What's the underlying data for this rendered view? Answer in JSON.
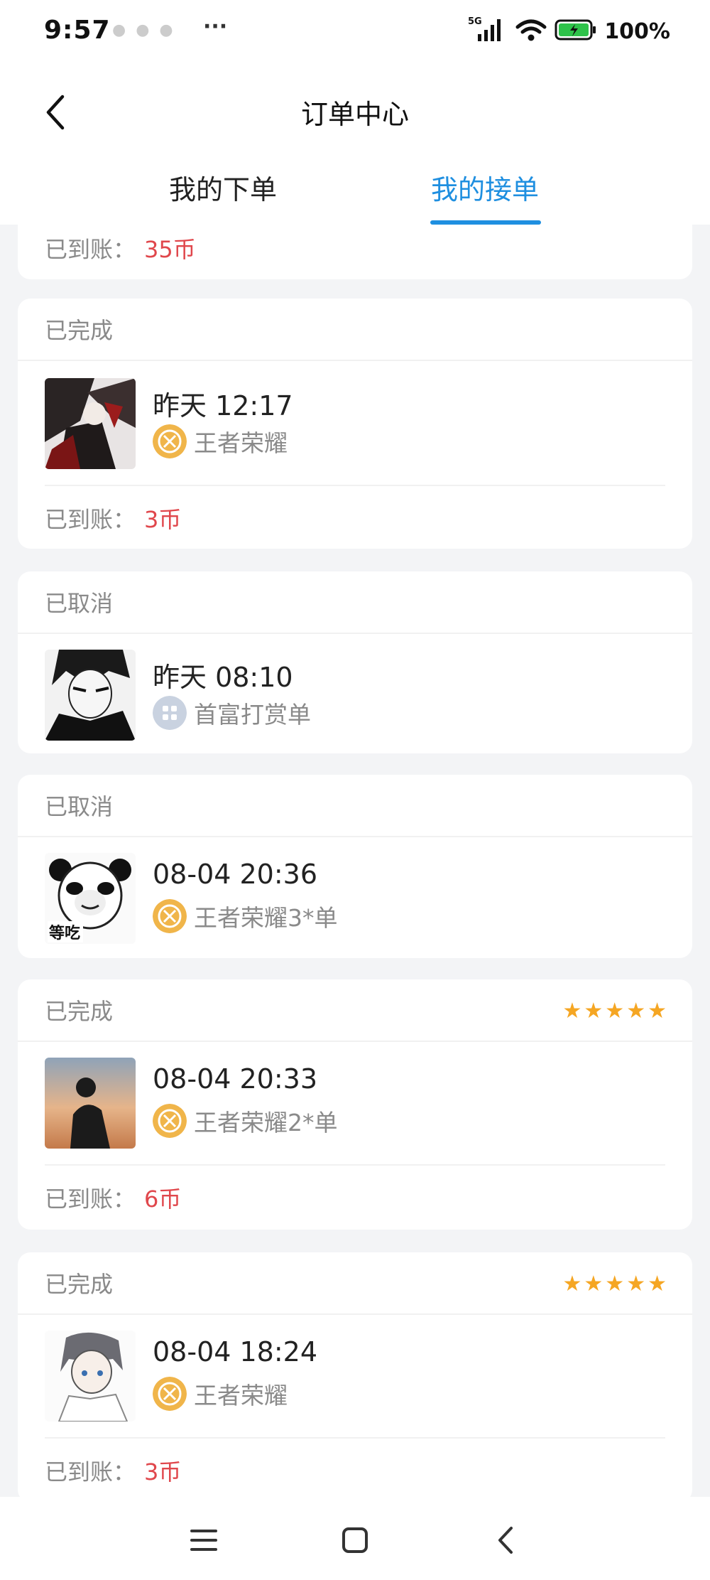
{
  "status_bar": {
    "time": "9:57",
    "more": "···",
    "network": "5G",
    "battery": "100%"
  },
  "header": {
    "title": "订单中心"
  },
  "tabs": [
    {
      "label": "我的下单",
      "active": false
    },
    {
      "label": "我的接单",
      "active": true
    }
  ],
  "colors": {
    "accent": "#1f8fe0",
    "paid": "#e0474c",
    "star": "#f5a623",
    "muted": "#8a8a8a"
  },
  "orders": [
    {
      "paid_label": "已到账：",
      "paid_value": "35币"
    },
    {
      "status": "已完成",
      "time": "昨天 12:17",
      "game": "王者荣耀",
      "icon": "honor-of-kings-icon",
      "paid_label": "已到账：",
      "paid_value": "3币"
    },
    {
      "status": "已取消",
      "time": "昨天 08:10",
      "game": "首富打赏单",
      "icon": "grid-app-icon"
    },
    {
      "status": "已取消",
      "time": "08-04 20:36",
      "game": "王者荣耀3*单",
      "icon": "honor-of-kings-icon"
    },
    {
      "status": "已完成",
      "time": "08-04 20:33",
      "game": "王者荣耀2*单",
      "icon": "honor-of-kings-icon",
      "stars": 5,
      "paid_label": "已到账：",
      "paid_value": "6币"
    },
    {
      "status": "已完成",
      "time": "08-04 18:24",
      "game": "王者荣耀",
      "icon": "honor-of-kings-icon",
      "stars": 5,
      "paid_label": "已到账：",
      "paid_value": "3币"
    }
  ],
  "avatar_stickers": {
    "panda_meme": "等吃"
  }
}
